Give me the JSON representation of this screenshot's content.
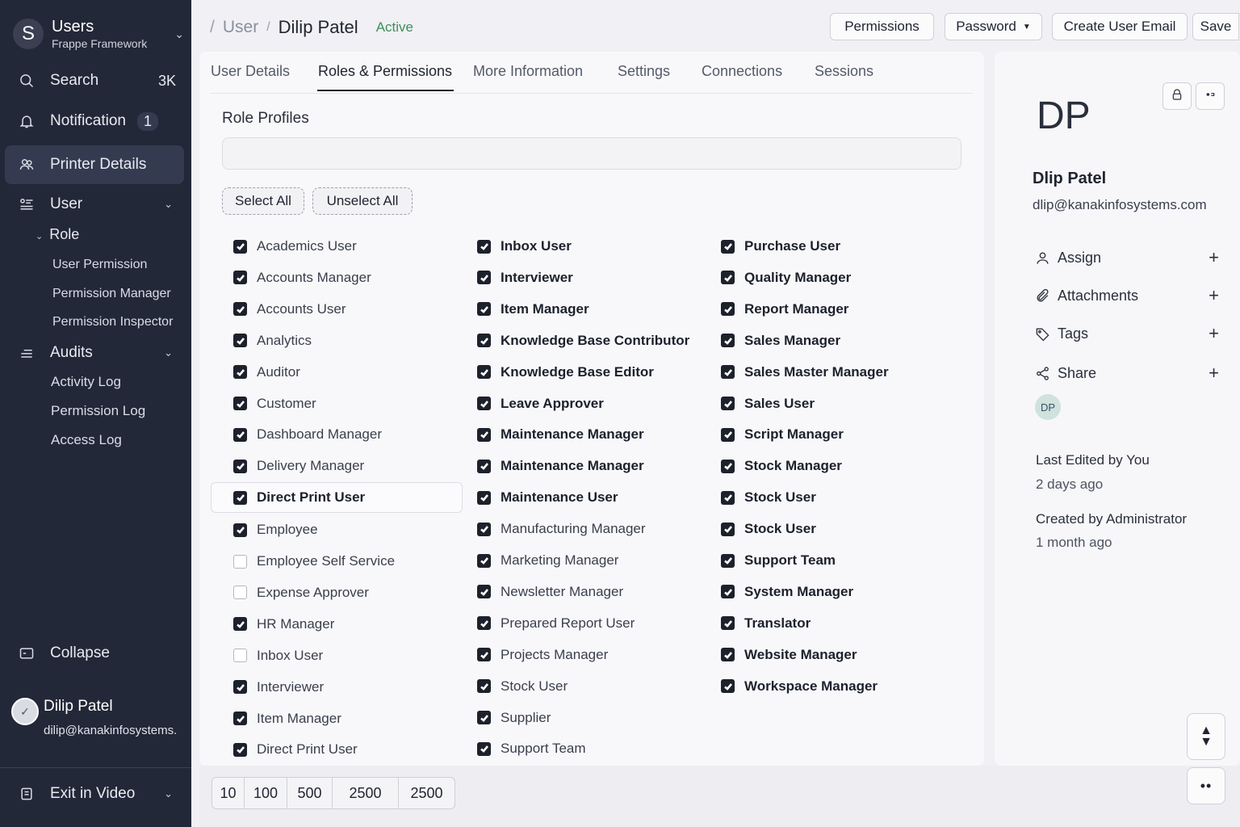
{
  "sidebar": {
    "app_title": "Users",
    "app_subtitle": "Frappe Framework",
    "logo_letter": "S",
    "search": {
      "label": "Search",
      "count": "3K"
    },
    "notification": {
      "label": "Notification",
      "badge": "1"
    },
    "printer_details": "Printer Details",
    "user": "User",
    "role": "Role",
    "role_items": [
      "User Permission",
      "Permission Manager",
      "Permission Inspector"
    ],
    "audits": "Audits",
    "audit_items": [
      "Activity Log",
      "Permission Log",
      "Access Log"
    ],
    "collapse": "Collapse",
    "current_user": {
      "name": "Dilip Patel",
      "email": "dilip@kanakinfosystems."
    },
    "exit": "Exit in Video"
  },
  "header": {
    "crumb_sep": "/",
    "crumb_doctype": "User",
    "crumb_name": "Dilip Patel",
    "status": "Active",
    "buttons": {
      "permissions": "Permissions",
      "password": "Password",
      "create_email": "Create User Email",
      "save": "Save"
    }
  },
  "tabs": [
    "User Details",
    "Roles & Permissions",
    "More Information",
    "Settings",
    "Connections",
    "Sessions"
  ],
  "active_tab": "Roles & Permissions",
  "role_profiles": {
    "label": "Role Profiles",
    "value": ""
  },
  "select_all": "Select All",
  "unselect_all": "Unselect All",
  "roles": {
    "col1": [
      {
        "label": "Academics User",
        "checked": true
      },
      {
        "label": "Accounts Manager",
        "checked": true
      },
      {
        "label": "Accounts User",
        "checked": true
      },
      {
        "label": "Analytics",
        "checked": true
      },
      {
        "label": "Auditor",
        "checked": true
      },
      {
        "label": "Customer",
        "checked": true
      },
      {
        "label": "Dashboard Manager",
        "checked": true
      },
      {
        "label": "Delivery Manager",
        "checked": true
      },
      {
        "label": "Direct Print User",
        "checked": true
      },
      {
        "label": "Employee",
        "checked": true
      },
      {
        "label": "Employee Self Service",
        "checked": false
      },
      {
        "label": "Expense Approver",
        "checked": false
      },
      {
        "label": "HR Manager",
        "checked": true
      },
      {
        "label": "Inbox User",
        "checked": false
      },
      {
        "label": "Interviewer",
        "checked": true
      },
      {
        "label": "Item Manager",
        "checked": true
      },
      {
        "label": "Direct Print User",
        "checked": true
      }
    ],
    "col2": [
      {
        "label": "Inbox User",
        "checked": true
      },
      {
        "label": "Interviewer",
        "checked": true
      },
      {
        "label": "Item Manager",
        "checked": true
      },
      {
        "label": "Knowledge Base Contributor",
        "checked": true
      },
      {
        "label": "Knowledge Base Editor",
        "checked": true
      },
      {
        "label": "Leave Approver",
        "checked": true
      },
      {
        "label": "Maintenance Manager",
        "checked": true
      },
      {
        "label": "Maintenance Manager",
        "checked": true
      },
      {
        "label": "Maintenance User",
        "checked": true
      },
      {
        "label": "Manufacturing Manager",
        "checked": true
      },
      {
        "label": "Marketing Manager",
        "checked": true
      },
      {
        "label": "Newsletter Manager",
        "checked": true
      },
      {
        "label": "Prepared Report User",
        "checked": true
      },
      {
        "label": "Projects Manager",
        "checked": true
      },
      {
        "label": "Stock User",
        "checked": true
      },
      {
        "label": "Supplier",
        "checked": true
      },
      {
        "label": "Support Team",
        "checked": true
      }
    ],
    "col3": [
      {
        "label": "Purchase User",
        "checked": true
      },
      {
        "label": "Quality Manager",
        "checked": true
      },
      {
        "label": "Report Manager",
        "checked": true
      },
      {
        "label": "Sales Manager",
        "checked": true
      },
      {
        "label": "Sales Master Manager",
        "checked": true
      },
      {
        "label": "Sales User",
        "checked": true
      },
      {
        "label": "Script Manager",
        "checked": true
      },
      {
        "label": "Stock Manager",
        "checked": true
      },
      {
        "label": "Stock User",
        "checked": true
      },
      {
        "label": "Stock User",
        "checked": true
      },
      {
        "label": "Support Team",
        "checked": true
      },
      {
        "label": "System Manager",
        "checked": true
      },
      {
        "label": "Translator",
        "checked": true
      },
      {
        "label": "Website Manager",
        "checked": true
      },
      {
        "label": "Workspace Manager",
        "checked": true
      }
    ]
  },
  "paginator": [
    "10",
    "100",
    "500",
    "2500",
    "2500"
  ],
  "right_panel": {
    "initials": "DP",
    "name": "Dlip Patel",
    "email": "dlip@kanakinfosystems.com",
    "assign": "Assign",
    "attachments": "Attachments",
    "tags": "Tags",
    "share": "Share",
    "share_avatar": "DP",
    "last_edited": "Last Edited by You",
    "last_edited_time": "2 days ago",
    "created": "Created by Administrator",
    "created_time": "1 month ago"
  },
  "colors": {
    "sidebar_bg": "#232838",
    "status_green": "#3d8f5a",
    "checkbox": "#1c212c"
  }
}
